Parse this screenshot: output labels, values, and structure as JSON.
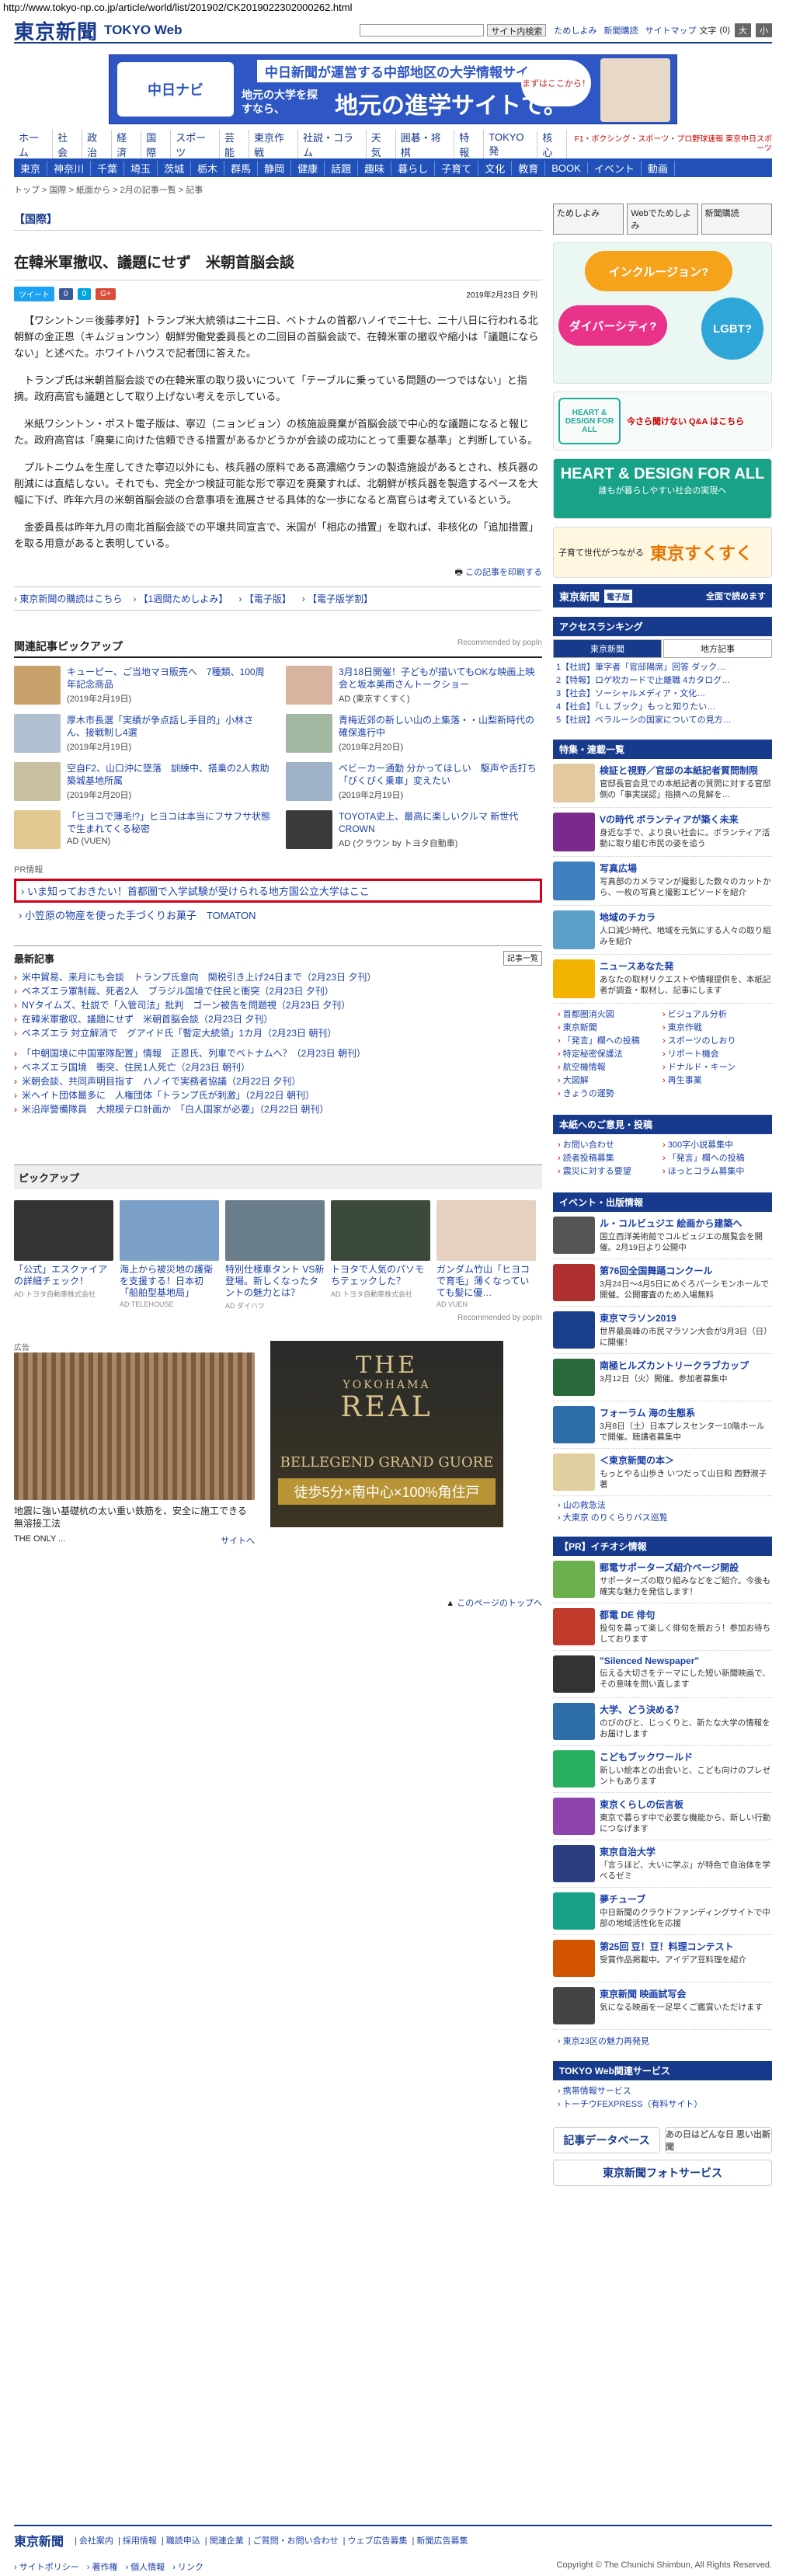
{
  "url": "http://www.tokyo-np.co.jp/article/world/list/201902/CK2019022302000262.html",
  "header": {
    "logo": "東京新聞",
    "logo_sub": "TOKYO Web",
    "search_btn": "サイト内検索",
    "links": [
      "ためしよみ",
      "新聞購読",
      "サイトマップ"
    ],
    "font_label": "文字",
    "font_size": "(0)",
    "font_big": "大",
    "font_small": "小"
  },
  "banner": {
    "top": "中日新聞が運営する中部地区の大学情報サイト",
    "logo": "中日ナビ",
    "mid": "地元の大学を探すなら、",
    "big": "地元の進学サイトで。",
    "bubble": "まずはここから！"
  },
  "nav1": [
    "ホーム",
    "社会",
    "政治",
    "経済",
    "国際",
    "スポーツ",
    "芸能",
    "東京作戦",
    "社説・コラム",
    "天気",
    "囲碁・将棋",
    "特報",
    "TOKYO発",
    "核心"
  ],
  "nav1_logo": "F1・ボクシング・スポーツ・プロ野球速報 東京中日スポーツ",
  "nav2": [
    "東京",
    "神奈川",
    "千葉",
    "埼玉",
    "茨城",
    "栃木",
    "群馬",
    "静岡",
    "健康",
    "話題",
    "趣味",
    "暮らし",
    "子育て",
    "文化",
    "教育",
    "BOOK",
    "イベント",
    "動画"
  ],
  "breadcrumb": "トップ > 国際 > 紙面から > 2月の記事一覧 > 記事",
  "section": "【国際】",
  "article": {
    "title": "在韓米軍撤収、議題にせず　米朝首脳会談",
    "date": "2019年2月23日 夕刊",
    "share": [
      "ツイート",
      "0",
      "0",
      "G+"
    ],
    "paras": [
      "【ワシントン＝後藤孝好】トランプ米大統領は二十二日、ベトナムの首都ハノイで二十七、二十八日に行われる北朝鮮の金正恩（キムジョンウン）朝鮮労働党委員長との二回目の首脳会談で、在韓米軍の撤収や縮小は「議題にならない」と述べた。ホワイトハウスで記者団に答えた。",
      "トランプ氏は米朝首脳会談での在韓米軍の取り扱いについて「テーブルに乗っている問題の一つではない」と指摘。政府高官も議題として取り上げない考えを示している。",
      "米紙ワシントン・ポスト電子版は、寧辺（ニョンビョン）の核施設廃棄が首脳会談で中心的な議題になると報じた。政府高官は「廃棄に向けた信頼できる措置があるかどうかが会談の成功にとって重要な基準」と判断している。",
      "プルトニウムを生産してきた寧辺以外にも、核兵器の原料である高濃縮ウランの製造施設があるとされ、核兵器の削減には直結しない。それでも、完全かつ検証可能な形で寧辺を廃棄すれば、北朝鮮が核兵器を製造するペースを大幅に下げ、昨年六月の米朝首脳会談の合意事項を進展させる具体的な一歩になると高官らは考えているという。",
      "金委員長は昨年九月の南北首脳会談での平壌共同宣言で、米国が「相応の措置」を取れば、非核化の「追加措置」を取る用意があると表明している。"
    ],
    "print": "この記事を印刷する"
  },
  "sublinks": [
    "東京新聞の購読はこちら",
    "【1週間ためしよみ】",
    "【電子版】",
    "【電子版学割】"
  ],
  "related": {
    "title": "関連記事ピックアップ",
    "rec": "Recommended by popIn",
    "items": [
      {
        "t": "キューピー、ご当地マヨ販売へ　7種類、100周年記念商品",
        "d": "(2019年2月19日)"
      },
      {
        "t": "3月18日開催！子どもが描いてもOKな映画上映会と坂本美雨さんトークショー",
        "d": "AD (東京すくすく)"
      },
      {
        "t": "厚木市長選「実績が争点話し手目的」小林さん、接戦制し4選",
        "d": "(2019年2月19日)"
      },
      {
        "t": "青梅近郊の新しい山の上集落・・山梨新時代の確保進行中",
        "d": "(2019年2月20日)"
      },
      {
        "t": "空自F2、山口沖に墜落　訓練中、搭乗の2人救助　築城基地所属",
        "d": "(2019年2月20日)"
      },
      {
        "t": "ベビーカー通勤 分かってほしい　駆声や舌打ち「びくびく乗車」変えたい",
        "d": "(2019年2月19日)"
      },
      {
        "t": "「ヒヨコで薄毛!?」ヒヨコは本当にフサフサ状態で生まれてくる秘密",
        "d": "AD (VUEN)"
      },
      {
        "t": "TOYOTA史上、最高に楽しいクルマ 新世代CROWN",
        "d": "AD (クラウン by トヨタ自動車)"
      }
    ]
  },
  "pr": {
    "label": "PR情報",
    "highlight": "いま知っておきたい！首都圏で入学試験が受けられる地方国公立大学はここ",
    "second": "小笠原の物産を使った手づくりお菓子　TOMATON"
  },
  "latest": {
    "title": "最新記事",
    "more": "記事一覧",
    "group1": [
      "米中貿易、来月にも会談　トランプ氏意向　関税引き上げ24日まで（2月23日 夕刊）",
      "ベネズエラ軍制裁、死者2人　ブラジル国境で住民と衝突（2月23日 夕刊）",
      "NYタイムズ、社説で「入管司法」批判　ゴーン被告を問題視（2月23日 夕刊）",
      "在韓米軍撤収、議題にせず　米朝首脳会談（2月23日 夕刊）",
      "ベネズエラ 対立解消で　グアイド氏「暫定大統領」1カ月（2月23日 朝刊）"
    ],
    "group2": [
      "「中朝国境に中国軍隊配置」情報　正恩氏、列車でベトナムへ？（2月23日 朝刊）",
      "ベネズエラ国境　衝突、住民1人死亡（2月23日 朝刊）",
      "米朝会談、共同声明目指す　ハノイで実務者協議（2月22日 夕刊）",
      "米ヘイト団体最多に　人権団体「トランプ氏が刺激」（2月22日 朝刊）",
      "米沿岸警備隊員　大規模テロ計画か　「白人国家が必要」（2月22日 朝刊）"
    ]
  },
  "pickup": {
    "title": "ピックアップ",
    "items": [
      {
        "t": "「公式」エスクァイアの詳細チェック！",
        "ad": "AD トヨタ自動車株式会社"
      },
      {
        "t": "海上から被災地の護衛を支援する！日本初「船舶型基地局」",
        "ad": "AD TELEHOUSE"
      },
      {
        "t": "特別仕様車タント VS新登場。新しくなったタントの魅力とは？",
        "ad": "AD ダイハツ"
      },
      {
        "t": "トヨタで人気のパソモちテェックした？",
        "ad": "AD トヨタ自動車株式会社"
      },
      {
        "t": "ガンダム竹山「ヒヨコで育毛」薄くなっていても髪に優…",
        "ad": "AD VUEN"
      }
    ],
    "rec": "Recommended by popIn"
  },
  "ads": {
    "ad1_label": "広告",
    "ad1_text": "地震に強い基礎杭の太い重い鉄筋を、安全に施工できる無溶接工法",
    "ad1_brand": "THE ONLY ...",
    "ad1_link": "サイトへ",
    "ad2_a": "THE",
    "ad2_b": "YOKOHAMA",
    "ad2_c": "REAL",
    "ad2_d": "BELLEGEND GRAND GUORE",
    "ad2_e": "徒歩5分×南中心×100%角住戸"
  },
  "totop": "このページのトップへ",
  "side": {
    "tabs": [
      "ためしよみ",
      "Webでためしよみ",
      "新聞購読"
    ],
    "hd_bubbles": [
      "インクルージョン?",
      "ダイバーシティ?",
      "LGBT?"
    ],
    "hd_logo": "HEART & DESIGN FOR ALL",
    "hd_link": "今さら聞けない Q&A はこちら",
    "hd3": "HEART & DESIGN FOR ALL",
    "hd3_sub": "誰もが暮らしやすい社会の実現へ",
    "kosodate_a": "子育て世代がつながる",
    "kosodate_b": "東京すくすく",
    "denshi": "東京新聞",
    "denshi_y": "電子版",
    "denshi_r": "全面で読めます",
    "rank_title": "アクセスランキング",
    "rank_tabs": [
      "東京新聞",
      "地方記事"
    ],
    "rank": [
      "1【社説】筆字者「官邸陽席」回答 ダック…",
      "2【特報】ロゲ吹カードで止離職 4カタログ…",
      "3【社会】ソーシャルメディア・文化…",
      "4【社会】「L L ブック」もっと知りたい…",
      "5【社説】ベラルーシの国家についての見方…"
    ],
    "feat_title": "特集・連載一覧",
    "feats": [
      {
        "t": "検証と視野／官邸の本紙記者質問制限",
        "s": "官邸長官会見での本紙記者の質問に対する官邸側の「事実誤認」指摘への見解を…"
      },
      {
        "t": "Vの時代 ボランティアが築く未来",
        "s": "身近な手で、より良い社会に。ボランティア活動に取り組む市民の姿を追う"
      },
      {
        "t": "写真広場",
        "s": "写真部のカメラマンが撮影した数々のカットから、一枚の写真と撮影エピソードを紹介"
      },
      {
        "t": "地域のチカラ",
        "s": "人口減少時代、地域を元気にする人々の取り組みを紹介"
      },
      {
        "t": "ニュースあなた発",
        "s": "あなたの取材リクエストや情報提供を、本紙記者が調査・取材し、記事にします"
      }
    ],
    "cats": [
      "首都圏消火図",
      "ビジュアル分析",
      "東京新聞",
      "東京作戦",
      "「発言」欄への投稿",
      "スポーツのしおり",
      "特定秘密保護法",
      "リポート機会",
      "航空機情報",
      "ドナルド・キーン",
      "大図解",
      "再生事業",
      "きょうの運勢"
    ],
    "info_title": "本紙へのご意見・投稿",
    "info": [
      "お問い合わせ",
      "300字小説募集中",
      "読者投稿募集",
      "「発言」欄への投稿",
      "震災に対する要望",
      "ほっとコラム募集中"
    ],
    "event_title": "イベント・出版情報",
    "events": [
      {
        "t": "ル・コルビュジエ 絵画から建築へ",
        "s": "国立西洋美術館でコルビュジエの展覧会を開催。2月19日より公開中"
      },
      {
        "t": "第76回全国舞踊コンクール",
        "s": "3月24日～4月5日にめぐろパーシモンホールで開催。公開審査のため入場無料"
      },
      {
        "t": "東京マラソン2019",
        "s": "世界最高峰の市民マラソン大会が3月3日（日）に開催！"
      },
      {
        "t": "南極ヒルズカントリークラブカップ",
        "s": "3月12日（火）開催。参加者募集中"
      },
      {
        "t": "フォーラム 海の生態系",
        "s": "3月8日（土）日本プレスセンター10階ホールで開催。聴講者募集中"
      },
      {
        "t": "＜東京新聞の本＞",
        "s": "もっとやる山歩き いつだって山日和 西野淑子 著"
      }
    ],
    "booklinks": [
      "山の救急法",
      "大東京 のりくらりバス巡覧"
    ],
    "pr_title": "【PR】イチオシ情報",
    "prs": [
      {
        "t": "郵電サポーターズ紹介ページ開設",
        "s": "サポーターズの取り組みなどをご紹介。今後も確実な魅力を発信します！"
      },
      {
        "t": "都電 DE 俳句",
        "s": "投句を募って楽しく俳句を競おう！参加お待ちしております"
      },
      {
        "t": "\"Silenced Newspaper\"",
        "s": "伝える大切さをテーマにした短い新聞映画で、その意味を問い直します"
      },
      {
        "t": "大学、どう決める？",
        "s": "のびのびと、じっくりと、新たな大学の情報をお届けします"
      },
      {
        "t": "こどもブックワールド",
        "s": "新しい絵本との出会いと、こども向けのプレゼントもあります"
      },
      {
        "t": "東京くらしの伝言板",
        "s": "東京で暮らす中で必要な機能から、新しい行動につなげます"
      },
      {
        "t": "東京自治大学",
        "s": "「言うほど、大いに学ぶ」が特色で自治体を学べるゼミ"
      },
      {
        "t": "夢チューブ",
        "s": "中日新聞のクラウドファンディングサイトで中部の地域活性化を応援"
      },
      {
        "t": "第25回 豆！豆！料理コンテスト",
        "s": "受賞作品掲載中。アイデア豆料理を紹介"
      },
      {
        "t": "東京新聞 映画試写会",
        "s": "気になる映画を一足早くご鑑賞いただけます"
      }
    ],
    "tokyo23": "東京23区の魅力再発見",
    "svc_title": "TOKYO Web関連サービス",
    "svcs": [
      "携帯情報サービス",
      "トーチウFEXPRESS（有料サイト）"
    ],
    "kizi": "記事データベース",
    "kizi2": "あの日はどんな日 思い出新聞",
    "photo": "東京新聞フォトサービス"
  },
  "footer": {
    "logo": "東京新聞",
    "l1": [
      "会社案内",
      "採用情報",
      "職読申込",
      "関連企業",
      "ご質問・お問い合わせ",
      "ウェブ広告募集",
      "新聞広告募集"
    ],
    "l2": [
      "サイトポリシー",
      "著作権",
      "個人情報",
      "リンク"
    ],
    "copy": "Copyright © The Chunichi Shimbun, All Rights Reserved."
  }
}
